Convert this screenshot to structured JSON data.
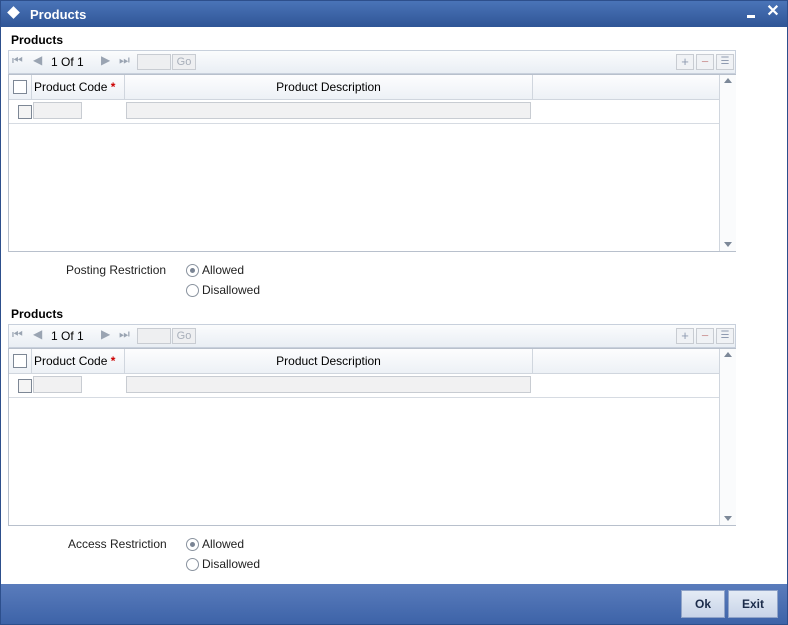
{
  "window": {
    "title": "Products",
    "close_glyph": "✕"
  },
  "posting_grid": {
    "section_label": "Products",
    "pager": {
      "current": "1",
      "of_label": "Of",
      "total": "1"
    },
    "go_label": "Go",
    "columns": {
      "code": "Product Code",
      "required_mark": "*",
      "description": "Product Description"
    }
  },
  "posting_restriction": {
    "label": "Posting Restriction",
    "options": [
      "Allowed",
      "Disallowed"
    ],
    "selected": "Allowed"
  },
  "access_grid": {
    "section_label": "Products",
    "pager": {
      "current": "1",
      "of_label": "Of",
      "total": "1"
    },
    "go_label": "Go",
    "columns": {
      "code": "Product Code",
      "required_mark": "*",
      "description": "Product Description"
    }
  },
  "access_restriction": {
    "label": "Access Restriction",
    "options": [
      "Allowed",
      "Disallowed"
    ],
    "selected": "Allowed"
  },
  "footer": {
    "ok_label": "Ok",
    "exit_label": "Exit"
  },
  "colors": {
    "titlebar": "#3a5fa4",
    "footer": "#4a6fb2",
    "required": "#cc0000"
  }
}
